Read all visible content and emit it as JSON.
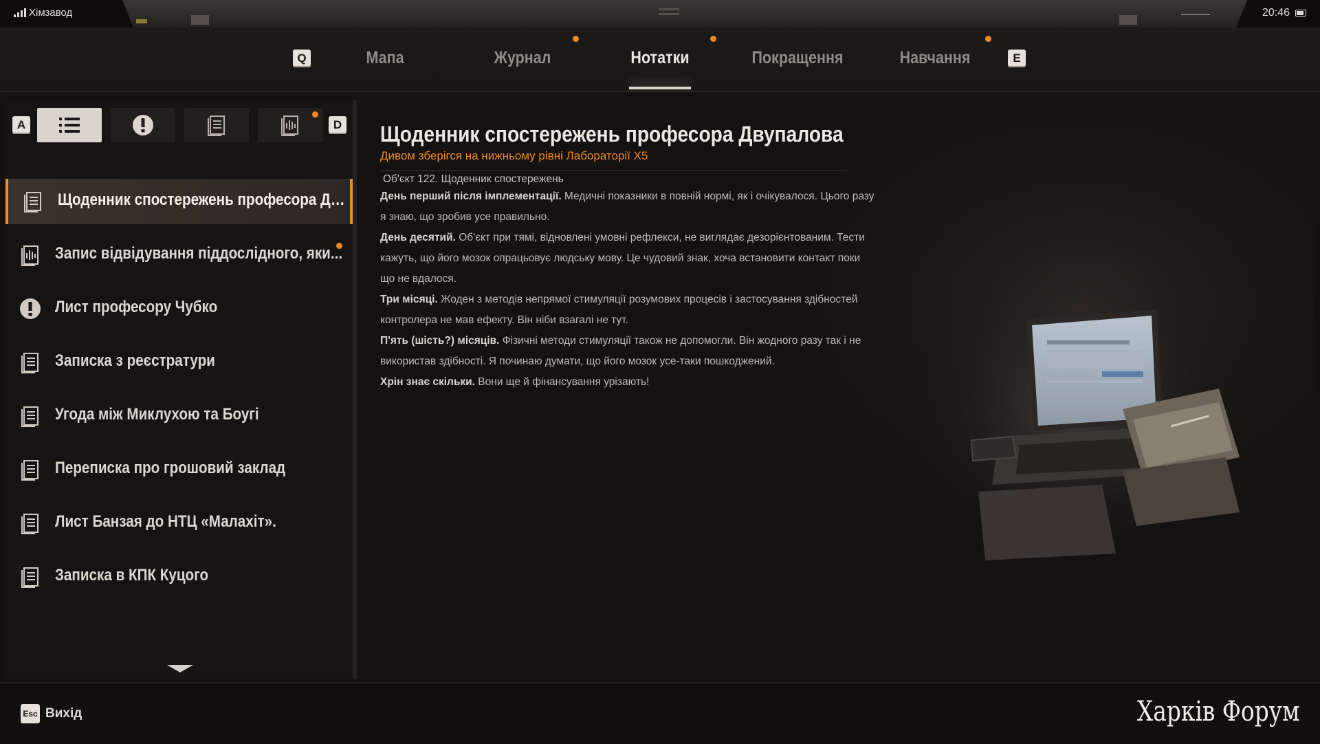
{
  "status_bar": {
    "carrier": "Хімзавод",
    "time": "20:46"
  },
  "tabs": {
    "left_key": "Q",
    "right_key": "E",
    "items": [
      {
        "label": "Мапа",
        "active": false,
        "dot": false
      },
      {
        "label": "Журнал",
        "active": false,
        "dot": true
      },
      {
        "label": "Нотатки",
        "active": true,
        "dot": true
      },
      {
        "label": "Покращення",
        "active": false,
        "dot": false
      },
      {
        "label": "Навчання",
        "active": false,
        "dot": true
      }
    ]
  },
  "filters": {
    "left_key": "A",
    "right_key": "D",
    "items": [
      {
        "icon": "list-icon",
        "active": true
      },
      {
        "icon": "exclamation-icon",
        "active": false
      },
      {
        "icon": "document-icon",
        "active": false
      },
      {
        "icon": "audio-icon",
        "active": false,
        "dot": true
      }
    ]
  },
  "notes": [
    {
      "label": "Щоденник спостережень професора Дву...",
      "icon": "document-icon",
      "selected": true,
      "dot": false
    },
    {
      "label": "Запис відвідування піддослідного, яки...",
      "icon": "audio-icon",
      "selected": false,
      "dot": true
    },
    {
      "label": "Лист професору Чубко",
      "icon": "exclamation-icon",
      "selected": false,
      "dot": false
    },
    {
      "label": "Записка з реєстратури",
      "icon": "document-icon",
      "selected": false,
      "dot": false
    },
    {
      "label": "Угода між Миклухою та Боугі",
      "icon": "document-icon",
      "selected": false,
      "dot": false
    },
    {
      "label": "Переписка про грошовий заклад",
      "icon": "document-icon",
      "selected": false,
      "dot": false
    },
    {
      "label": "Лист Банзая до НТЦ «Малахіт».",
      "icon": "document-icon",
      "selected": false,
      "dot": false
    },
    {
      "label": "Записка в КПК Куцого",
      "icon": "document-icon",
      "selected": false,
      "dot": false
    }
  ],
  "document": {
    "title": "Щоденник спостережень професора Двупалова",
    "subtitle": "Дивом зберігся на нижньому рівні Лабораторії Х5",
    "header": "Об'єкт 122. Щоденник спостережень",
    "entries": [
      {
        "heading": "День перший після імплементації.",
        "text": " Медичні показники в повній нормі, як і очікувалося. Цього разу я знаю, що зробив усе правильно."
      },
      {
        "heading": "День десятий.",
        "text": " Об'єкт при тямі, відновлені умовні рефлекси, не виглядає дезорієнтованим. Тести кажуть, що його мозок опрацьовує людську мову. Це чудовий знак, хоча встановити контакт поки що не вдалося."
      },
      {
        "heading": "Три місяці.",
        "text": "  Жоден з методів непрямої стимуляції розумових процесів і застосування здібностей контролера не мав ефекту. Він ніби взагалі не тут."
      },
      {
        "heading": "П'ять (шість?) місяців.",
        "text": " Фізичні методи стимуляції також не допомогли. Він жодного разу так і не використав здібності. Я починаю думати, що його мозок усе-таки пошкоджений."
      },
      {
        "heading": "Хрін знає скільки.",
        "text": "  Вони ще й фінансування урізають!"
      }
    ]
  },
  "bottom": {
    "esc_key": "Esc",
    "exit_label": "Вихід",
    "watermark": "Харків Форум"
  },
  "colors": {
    "accent": "#e98a25",
    "text": "#dcd7d0",
    "panel": "#161412"
  }
}
